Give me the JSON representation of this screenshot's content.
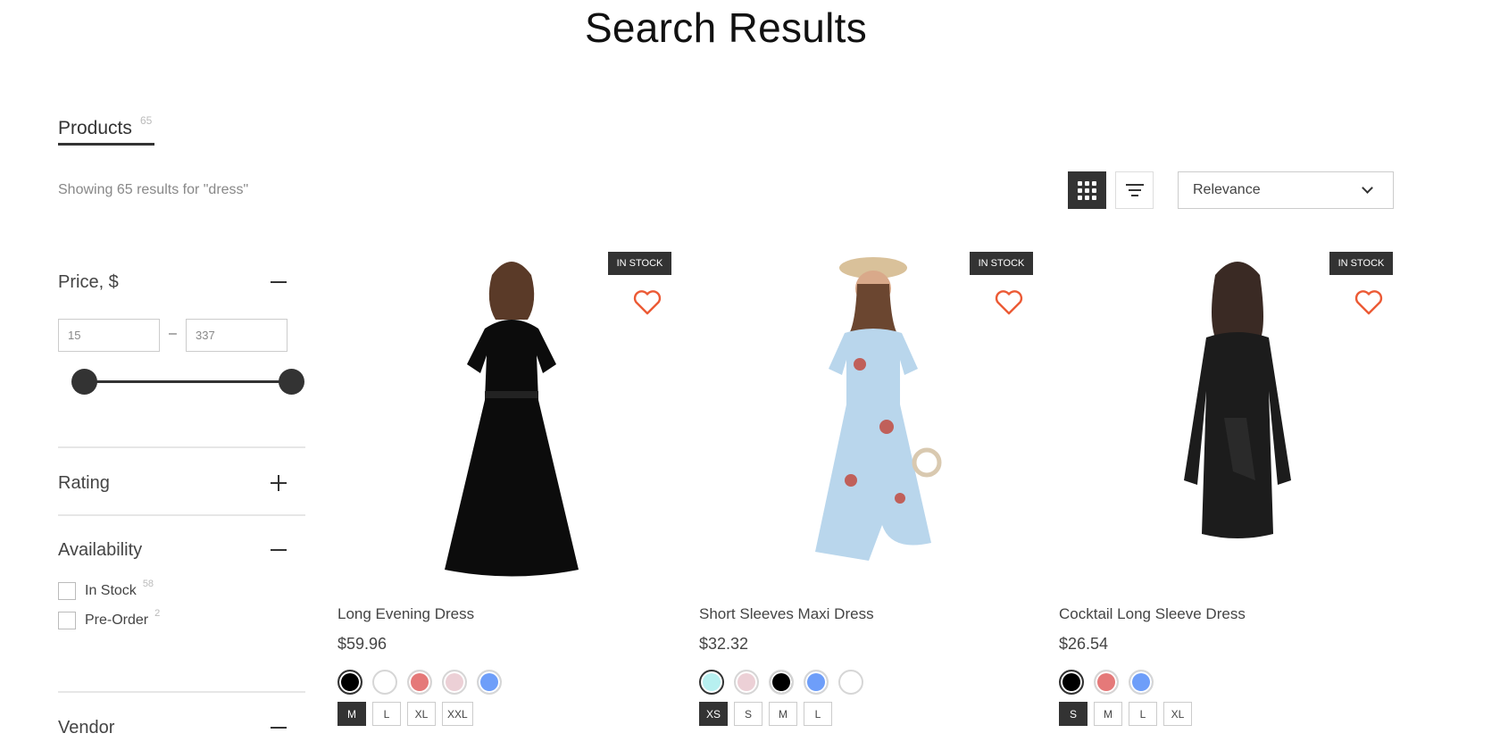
{
  "header": {
    "title": "Search Results"
  },
  "tabs": [
    {
      "label": "Products",
      "count": "65",
      "active": true
    }
  ],
  "results_summary": "Showing 65 results for \"dress\"",
  "toolbar": {
    "view_grid_icon": "grid-icon",
    "view_list_icon": "list-icon",
    "active_view": "grid",
    "sort": {
      "selected": "Relevance"
    }
  },
  "filters": {
    "price": {
      "title": "Price, $",
      "expanded": true,
      "min": "15",
      "max": "337",
      "separator": "–",
      "range_min_fraction": 0,
      "range_max_fraction": 1
    },
    "rating": {
      "title": "Rating",
      "expanded": false
    },
    "availability": {
      "title": "Availability",
      "expanded": true,
      "options": [
        {
          "label": "In Stock",
          "count": "58",
          "checked": false
        },
        {
          "label": "Pre-Order",
          "count": "2",
          "checked": false
        }
      ]
    },
    "vendor": {
      "title": "Vendor",
      "expanded": true
    }
  },
  "products": [
    {
      "name": "Long Evening Dress",
      "price": "$59.96",
      "badge": "IN STOCK",
      "colors": [
        "#000000",
        "#ffffff",
        "#e57979",
        "#ecd0d6",
        "#6e9ef9"
      ],
      "selected_color": 0,
      "sizes": [
        "M",
        "L",
        "XL",
        "XXL"
      ],
      "selected_size": 0
    },
    {
      "name": "Short Sleeves Maxi Dress",
      "price": "$32.32",
      "badge": "IN STOCK",
      "colors": [
        "#b7f0f0",
        "#ecd0d6",
        "#000000",
        "#6e9ef9",
        "#ffffff"
      ],
      "selected_color": 0,
      "sizes": [
        "XS",
        "S",
        "M",
        "L"
      ],
      "selected_size": 0
    },
    {
      "name": "Cocktail Long Sleeve Dress",
      "price": "$26.54",
      "badge": "IN STOCK",
      "colors": [
        "#000000",
        "#e57979",
        "#6e9ef9"
      ],
      "selected_color": 0,
      "sizes": [
        "S",
        "M",
        "L",
        "XL"
      ],
      "selected_size": 0
    }
  ],
  "colors": {
    "accent_heart": "#ec5a35",
    "dark": "#333333"
  }
}
